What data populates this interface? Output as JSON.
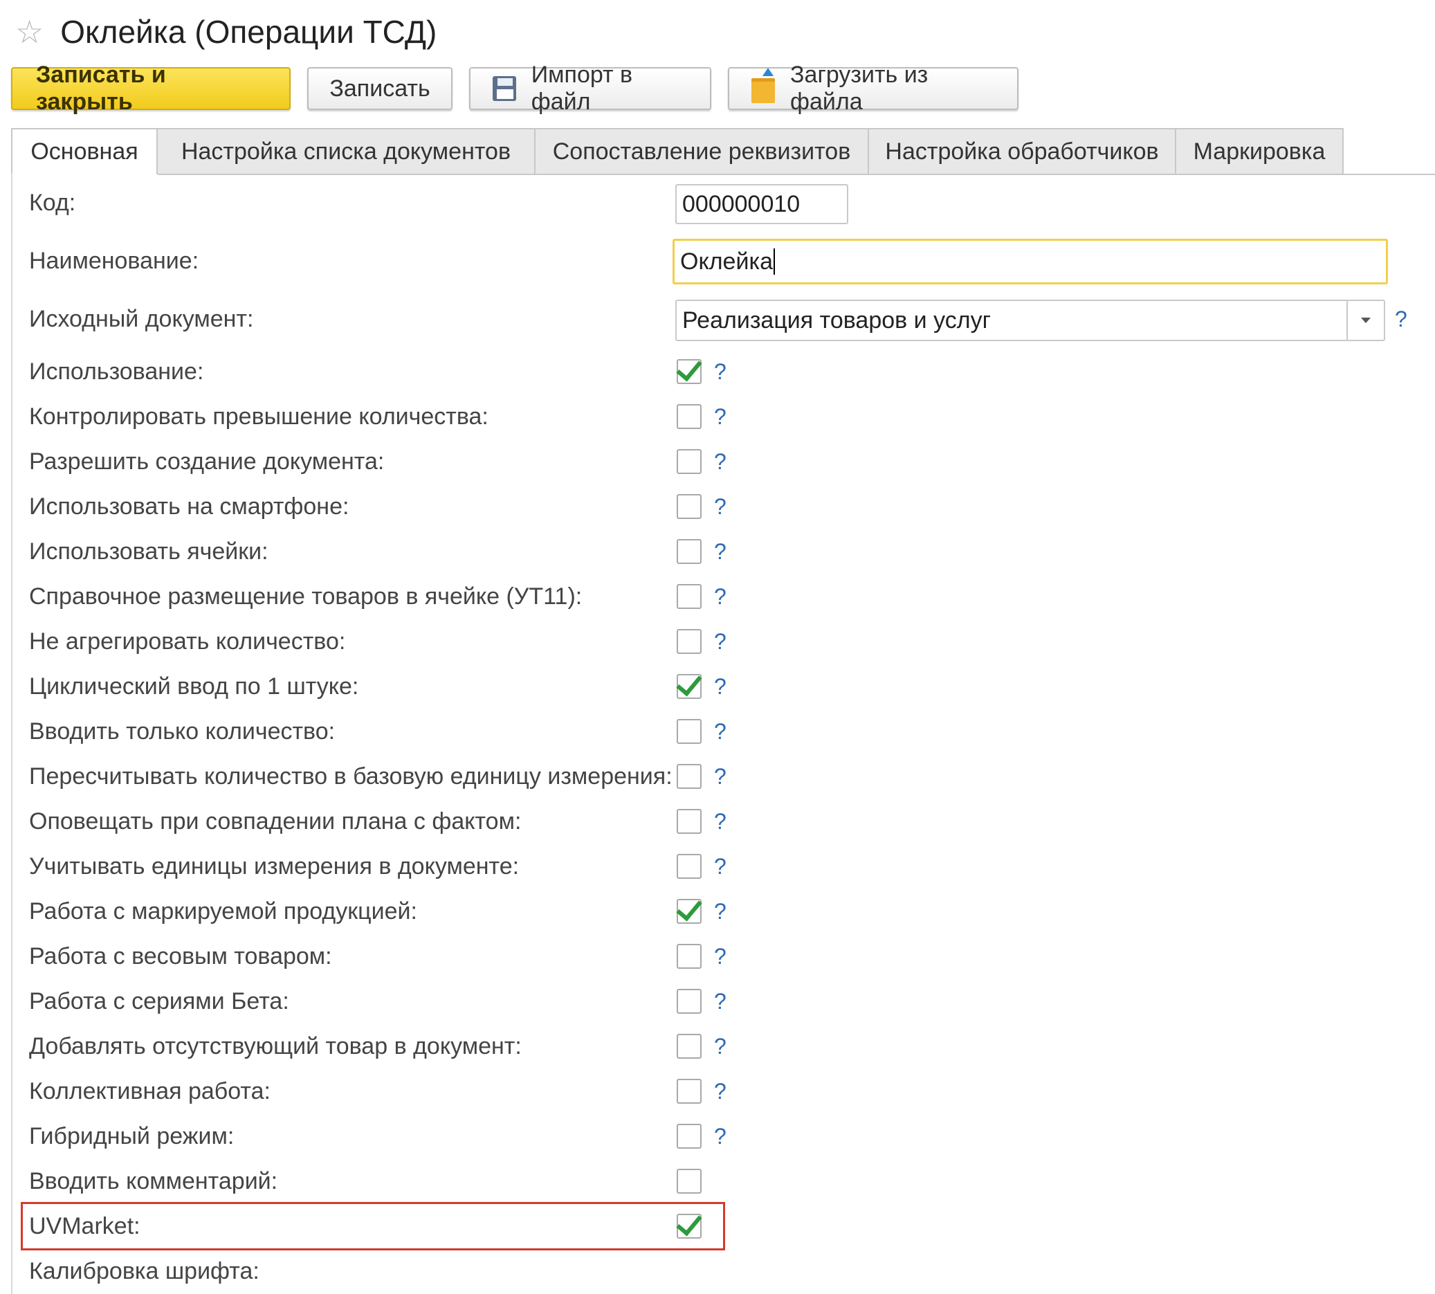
{
  "window": {
    "title": "Оклейка (Операции ТСД)"
  },
  "toolbar": {
    "save_close": "Записать и закрыть",
    "save": "Записать",
    "import": "Импорт в файл",
    "load": "Загрузить из файла"
  },
  "tabs": [
    "Основная",
    "Настройка списка документов",
    "Сопоставление реквизитов",
    "Настройка обработчиков",
    "Маркировка"
  ],
  "fields": {
    "code_label": "Код:",
    "code_value": "000000010",
    "name_label": "Наименование:",
    "name_value": "Оклейка",
    "source_doc_label": "Исходный документ:",
    "source_doc_value": "Реализация товаров и услуг",
    "help_mark": "?"
  },
  "checkboxes": [
    {
      "label": "Использование:",
      "checked": true
    },
    {
      "label": "Контролировать превышение количества:",
      "checked": false
    },
    {
      "label": "Разрешить создание документа:",
      "checked": false
    },
    {
      "label": "Использовать на смартфоне:",
      "checked": false
    },
    {
      "label": "Использовать ячейки:",
      "checked": false
    },
    {
      "label": "Справочное размещение товаров в ячейке (УТ11):",
      "checked": false
    },
    {
      "label": "Не агрегировать количество:",
      "checked": false
    },
    {
      "label": "Циклический ввод по 1 штуке:",
      "checked": true
    },
    {
      "label": "Вводить только количество:",
      "checked": false
    },
    {
      "label": "Пересчитывать количество в базовую единицу измерения:",
      "checked": false
    },
    {
      "label": "Оповещать при совпадении плана с фактом:",
      "checked": false
    },
    {
      "label": "Учитывать единицы измерения в документе:",
      "checked": false
    },
    {
      "label": "Работа с маркируемой продукцией:",
      "checked": true
    },
    {
      "label": "Работа с весовым товаром:",
      "checked": false
    },
    {
      "label": "Работа с сериями Бета:",
      "checked": false
    },
    {
      "label": "Добавлять отсутствующий товар в документ:",
      "checked": false
    },
    {
      "label": "Коллективная работа:",
      "checked": false
    },
    {
      "label": "Гибридный режим:",
      "checked": false
    },
    {
      "label": "Вводить комментарий:",
      "checked": false
    },
    {
      "label": "UVMarket:",
      "checked": true
    },
    {
      "label": "Калибровка шрифта:",
      "checked": false
    }
  ],
  "colors": {
    "primary_button": "#f2cc1c",
    "checkmark": "#2e9a3c",
    "help_link": "#2f6ab3",
    "highlight_border": "#d43b2a",
    "focus_border": "#f2cf4a"
  }
}
